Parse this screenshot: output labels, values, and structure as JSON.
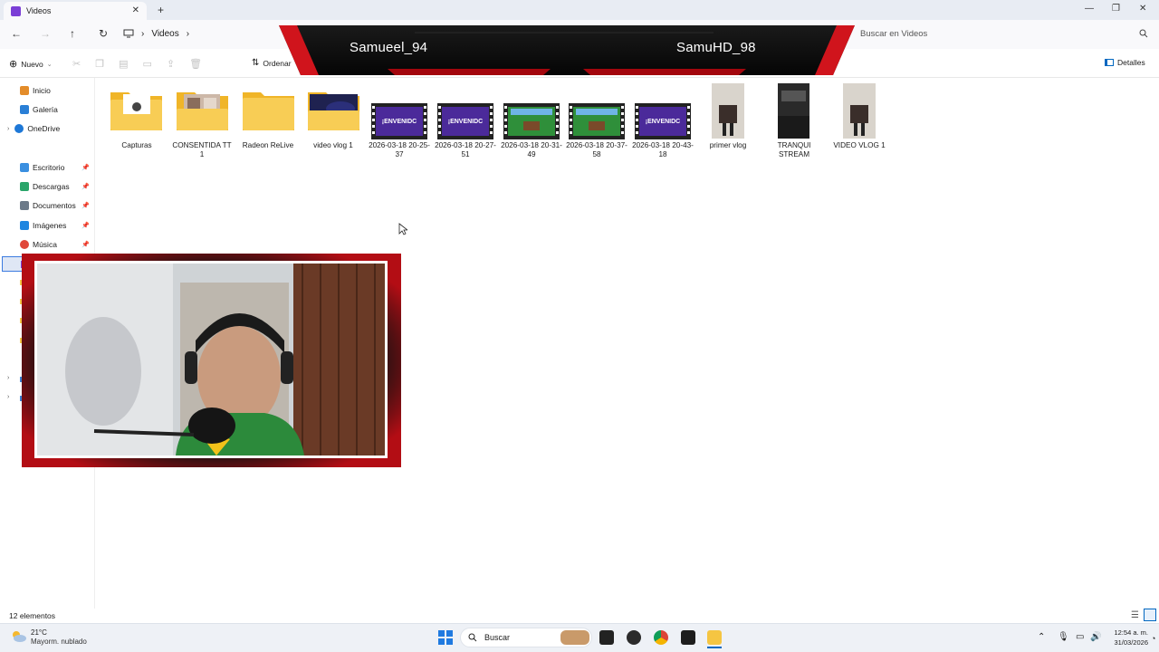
{
  "window": {
    "tab_title": "Videos",
    "new_tab": "+",
    "close_tab": "✕",
    "minimize": "—",
    "maximize": "❐",
    "close": "✕"
  },
  "nav": {
    "back": "←",
    "forward": "→",
    "up": "↑",
    "refresh": "↻",
    "breadcrumb": [
      "Videos"
    ],
    "chevron": "›",
    "search_placeholder": "Buscar en Videos"
  },
  "toolbar": {
    "new_label": "Nuevo",
    "sort_label": "Ordenar",
    "details_label": "Detalles"
  },
  "overlay": {
    "left_name": "Samueel_94",
    "right_name": "SamuHD_98"
  },
  "sidebar": {
    "items": [
      {
        "label": "Inicio",
        "icon": "home-icon"
      },
      {
        "label": "Galería",
        "icon": "gallery-icon"
      },
      {
        "label": "OneDrive",
        "icon": "cloud-icon"
      },
      {
        "label": "Escritorio",
        "icon": "desktop-icon"
      },
      {
        "label": "Descargas",
        "icon": "download-icon"
      },
      {
        "label": "Documentos",
        "icon": "documents-icon"
      },
      {
        "label": "Imágenes",
        "icon": "images-icon"
      },
      {
        "label": "Música",
        "icon": "music-icon"
      }
    ]
  },
  "files": [
    {
      "name": "Capturas",
      "kind": "folder"
    },
    {
      "name": "CONSENTIDA TT 1",
      "kind": "folder"
    },
    {
      "name": "Radeon ReLive",
      "kind": "folder"
    },
    {
      "name": "video vlog 1",
      "kind": "folder"
    },
    {
      "name": "2026-03-18 20-25-37",
      "kind": "video-purple"
    },
    {
      "name": "2026-03-18 20-27-51",
      "kind": "video-purple"
    },
    {
      "name": "2026-03-18 20-31-49",
      "kind": "video-green"
    },
    {
      "name": "2026-03-18 20-37-58",
      "kind": "video-green"
    },
    {
      "name": "2026-03-18 20-43-18",
      "kind": "video-purple"
    },
    {
      "name": "primer vlog",
      "kind": "video-portrait"
    },
    {
      "name": "TRANQUI STREAM",
      "kind": "video-dark"
    },
    {
      "name": "VIDEO VLOG 1",
      "kind": "video-portrait"
    }
  ],
  "thumb_text": "¡ENVENIDC",
  "status": {
    "count": "12 elementos"
  },
  "taskbar": {
    "weather_temp": "21°C",
    "weather_desc": "Mayorm. nublado",
    "search": "Buscar",
    "time": "12:54 a. m.",
    "date": "31/03/2026"
  },
  "colors": {
    "accent": "#0067c0",
    "folder": "#f5c542",
    "overlay_red": "#d0141c",
    "video_purple": "#4b2a9a",
    "video_green": "#2f8f3a"
  }
}
